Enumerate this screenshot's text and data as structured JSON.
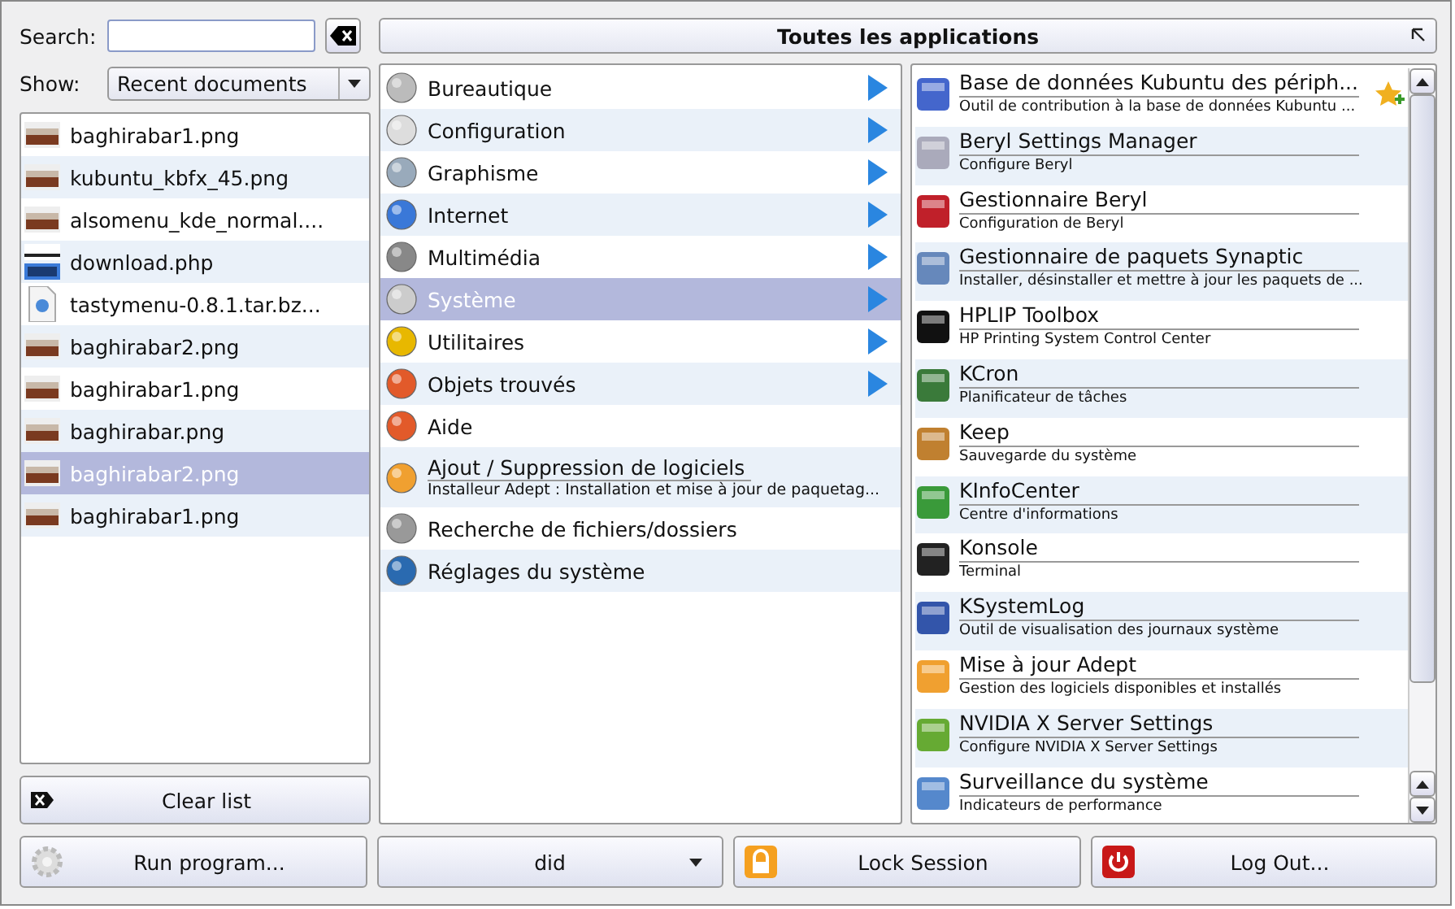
{
  "search": {
    "label": "Search:"
  },
  "show": {
    "label": "Show:",
    "value": "Recent documents"
  },
  "header": {
    "title": "Toutes les applications"
  },
  "recent": [
    {
      "name": "baghirabar1.png",
      "kind": "image",
      "selected": false
    },
    {
      "name": "kubuntu_kbfx_45.png",
      "kind": "image",
      "selected": false
    },
    {
      "name": "alsomenu_kde_normal....",
      "kind": "image",
      "selected": false
    },
    {
      "name": "download.php",
      "kind": "web",
      "selected": false
    },
    {
      "name": "tastymenu-0.8.1.tar.bz...",
      "kind": "archive",
      "selected": false
    },
    {
      "name": "baghirabar2.png",
      "kind": "image",
      "selected": false
    },
    {
      "name": "baghirabar1.png",
      "kind": "image",
      "selected": false
    },
    {
      "name": "baghirabar.png",
      "kind": "image",
      "selected": false
    },
    {
      "name": "baghirabar2.png",
      "kind": "image",
      "selected": true
    },
    {
      "name": "baghirabar1.png",
      "kind": "image",
      "selected": false
    }
  ],
  "clear_button": "Clear list",
  "categories": [
    {
      "name": "Bureautique",
      "submenu": true,
      "selected": false
    },
    {
      "name": "Configuration",
      "submenu": true,
      "selected": false
    },
    {
      "name": "Graphisme",
      "submenu": true,
      "selected": false
    },
    {
      "name": "Internet",
      "submenu": true,
      "selected": false
    },
    {
      "name": "Multimédia",
      "submenu": true,
      "selected": false
    },
    {
      "name": "Système",
      "submenu": true,
      "selected": true
    },
    {
      "name": "Utilitaires",
      "submenu": true,
      "selected": false
    },
    {
      "name": "Objets trouvés",
      "submenu": true,
      "selected": false
    },
    {
      "name": "Aide",
      "submenu": false,
      "selected": false
    },
    {
      "name": "Ajout / Suppression de logiciels",
      "description": "Installeur Adept : Installation et mise à jour de paquetag...",
      "submenu": false,
      "selected": false
    },
    {
      "name": "Recherche de fichiers/dossiers",
      "submenu": false,
      "selected": false
    },
    {
      "name": "Réglages du système",
      "submenu": false,
      "selected": false
    }
  ],
  "apps": [
    {
      "name": "Base de données Kubuntu des périph...",
      "description": "Outil de contribution à la base de données Kubuntu ...",
      "favorite_button": true
    },
    {
      "name": "Beryl Settings Manager",
      "description": "Configure Beryl",
      "favorite_button": false
    },
    {
      "name": "Gestionnaire Beryl",
      "description": "Configuration de Beryl",
      "favorite_button": false
    },
    {
      "name": "Gestionnaire de paquets Synaptic",
      "description": "Installer, désinstaller et mettre à jour les paquets de ...",
      "favorite_button": false
    },
    {
      "name": "HPLIP Toolbox",
      "description": "HP Printing System Control Center",
      "favorite_button": false
    },
    {
      "name": "KCron",
      "description": "Planificateur de tâches",
      "favorite_button": false
    },
    {
      "name": "Keep",
      "description": "Sauvegarde du système",
      "favorite_button": false
    },
    {
      "name": "KInfoCenter",
      "description": "Centre d'informations",
      "favorite_button": false
    },
    {
      "name": "Konsole",
      "description": "Terminal",
      "favorite_button": false
    },
    {
      "name": "KSystemLog",
      "description": "Outil de visualisation des journaux système",
      "favorite_button": false
    },
    {
      "name": "Mise à jour Adept",
      "description": "Gestion des logiciels disponibles et installés",
      "favorite_button": false
    },
    {
      "name": "NVIDIA X Server Settings",
      "description": "Configure NVIDIA X Server Settings",
      "favorite_button": false
    },
    {
      "name": "Surveillance du système",
      "description": "Indicateurs de performance",
      "favorite_button": false
    }
  ],
  "bottom": {
    "run": "Run program...",
    "user": "did",
    "lock": "Lock Session",
    "logout": "Log Out..."
  }
}
